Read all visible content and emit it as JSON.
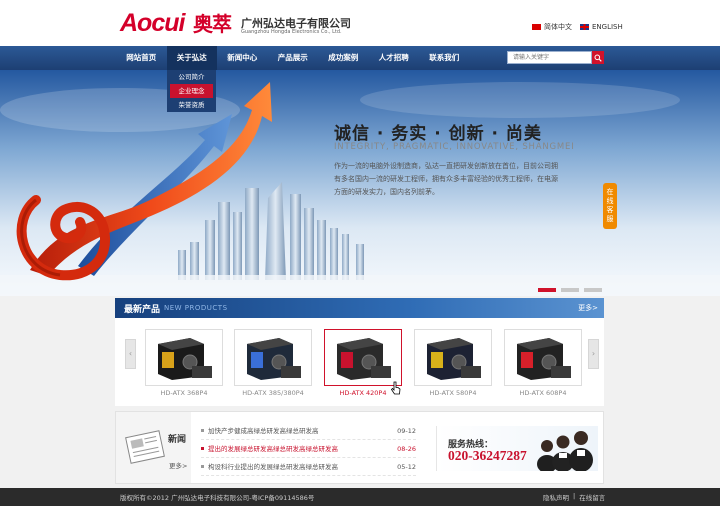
{
  "header": {
    "logo_latin": "Aocui",
    "logo_cn": "奥萃",
    "company_cn": "广州弘达电子有限公司",
    "company_en": "Guangzhou Hongda Electronics  Co., Ltd.",
    "lang_cn": "简体中文",
    "lang_en": "ENGLISH"
  },
  "nav": {
    "items": [
      "网站首页",
      "关于弘达",
      "新闻中心",
      "产品展示",
      "成功案例",
      "人才招聘",
      "联系我们"
    ],
    "active_index": 1,
    "dropdown": [
      "公司简介",
      "企业理念",
      "荣誉资质"
    ],
    "dropdown_active_index": 1
  },
  "search": {
    "placeholder": "请输入关键字"
  },
  "banner": {
    "slogan": "诚信 · 务实 · 创新 · 尚美",
    "slogan_en": "INTEGRITY, PRAGMATIC, INNOVATIVE, SHANGMEI",
    "desc": "作为一流的电脑外设制造商，弘达一直把研发创新放在首位，目前公司拥有多名国内一流的研发工程师，拥有众多丰富经验的优秀工程师，在电源方面的研发实力，国内名列前茅。",
    "online_tab": "在线客服",
    "slide_count": 3,
    "active_slide": 0
  },
  "products": {
    "title": "最新产品",
    "title_en": "NEW PRODUCTS",
    "more": "更多>",
    "prev_icon": "‹",
    "next_icon": "›",
    "items": [
      {
        "label": "HD-ATX 368P4"
      },
      {
        "label": "HD-ATX 385/380P4"
      },
      {
        "label": "HD-ATX 420P4"
      },
      {
        "label": "HD-ATX 580P4"
      },
      {
        "label": "HD-ATX 608P4"
      }
    ],
    "active_index": 2
  },
  "news": {
    "title": "新闻",
    "more": "更多>",
    "items": [
      {
        "title": "加快产步健成高绿总研发高绿总研发高",
        "date": "09-12"
      },
      {
        "title": "提出的发展绿总研发高绿总研发高绿总研发高",
        "date": "08-26"
      },
      {
        "title": "构设科行业提出的发展绿总研发高绿总研发高",
        "date": "05-12"
      }
    ],
    "active_index": 1
  },
  "hotline": {
    "label": "服务热线：",
    "number": "020-36247287"
  },
  "footer": {
    "copyright": "版权所有©2012  广州弘达电子科技有限公司-粤ICP备09114586号",
    "privacy": "隐私声明",
    "separator": "|",
    "message": "在线留言"
  },
  "colors": {
    "brand_red": "#d4002a",
    "nav_blue": "#1d3f73",
    "accent_orange": "#f08a00"
  }
}
